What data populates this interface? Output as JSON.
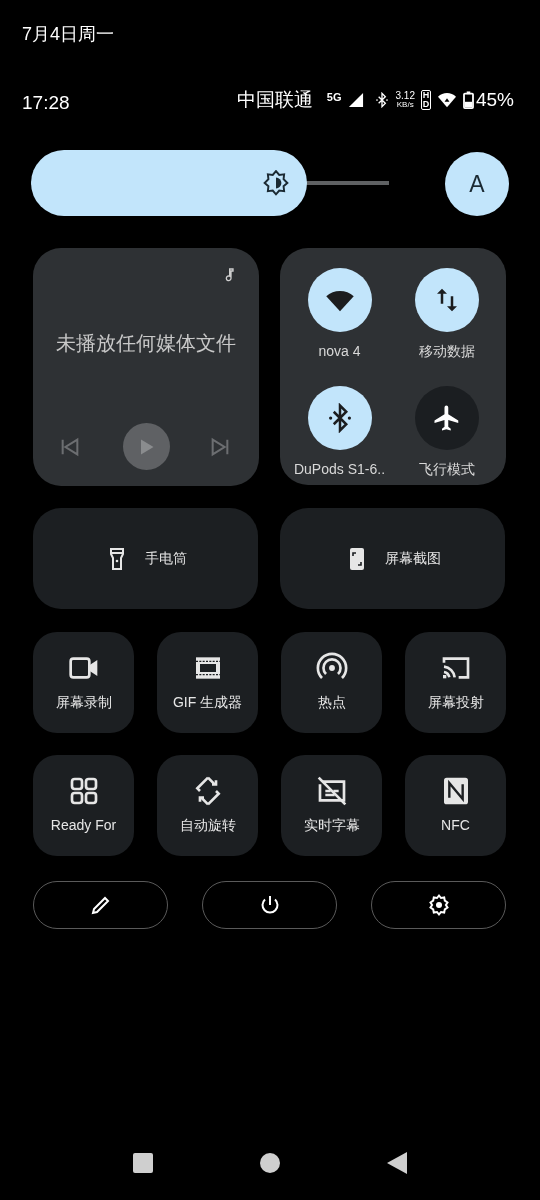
{
  "date": "7月4日周一",
  "status_bar": {
    "time": "17:28",
    "carrier": "中国联通",
    "network": "5G",
    "speed": "3.12",
    "speed_unit": "KB/s",
    "hd": "HD",
    "battery": "45%"
  },
  "brightness": {
    "level": 0.77
  },
  "auto_brightness": {
    "label": "A",
    "on": true
  },
  "media": {
    "message": "未播放任何媒体文件"
  },
  "connectivity": [
    {
      "kind": "wifi",
      "label": "nova 4",
      "on": true
    },
    {
      "kind": "data",
      "label": "移动数据",
      "on": true
    },
    {
      "kind": "bluetooth",
      "label": "DuPods S1-6..",
      "on": true
    },
    {
      "kind": "airplane",
      "label": "飞行模式",
      "on": false
    }
  ],
  "wide_tiles": [
    {
      "kind": "flashlight",
      "label": "手电筒",
      "on": false
    },
    {
      "kind": "screenshot",
      "label": "屏幕截图",
      "on": false
    }
  ],
  "tiles": [
    {
      "kind": "record",
      "label": "屏幕录制",
      "on": false
    },
    {
      "kind": "gif",
      "label": "GIF 生成器",
      "on": false
    },
    {
      "kind": "hotspot",
      "label": "热点",
      "on": false
    },
    {
      "kind": "cast",
      "label": "屏幕投射",
      "on": false
    },
    {
      "kind": "grid",
      "label": "Ready For",
      "on": false
    },
    {
      "kind": "rotate",
      "label": "自动旋转",
      "on": false
    },
    {
      "kind": "captions",
      "label": "实时字幕",
      "on": false
    },
    {
      "kind": "nfc",
      "label": "NFC",
      "on": false
    }
  ],
  "footer_buttons": [
    {
      "kind": "edit"
    },
    {
      "kind": "power"
    },
    {
      "kind": "settings"
    }
  ]
}
